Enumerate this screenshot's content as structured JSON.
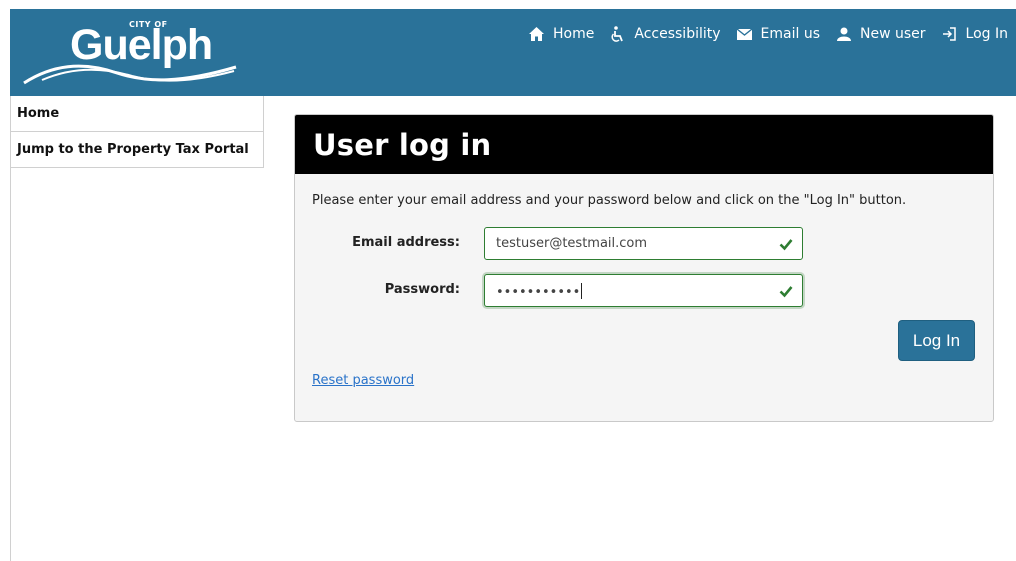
{
  "header": {
    "logo": {
      "city_of": "CITY OF",
      "name": "Guelph"
    },
    "nav": [
      {
        "label": "Home",
        "icon": "home-icon"
      },
      {
        "label": "Accessibility",
        "icon": "wheelchair-icon"
      },
      {
        "label": "Email us",
        "icon": "envelope-icon"
      },
      {
        "label": "New user",
        "icon": "user-icon"
      },
      {
        "label": "Log In",
        "icon": "login-icon"
      }
    ]
  },
  "sidebar": {
    "items": [
      {
        "label": "Home"
      },
      {
        "label": "Jump to the Property Tax Portal"
      }
    ]
  },
  "login": {
    "title": "User log in",
    "instructions": "Please enter your email address and your password below and click on the \"Log In\" button.",
    "email_label": "Email address:",
    "email_value": "testuser@testmail.com",
    "password_label": "Password:",
    "password_value": "•••••••••••",
    "submit_label": "Log In",
    "reset_label": "Reset password"
  },
  "colors": {
    "brand": "#2a7299",
    "panel_header": "#000000",
    "valid": "#2e7d32",
    "link": "#2a73c9"
  }
}
